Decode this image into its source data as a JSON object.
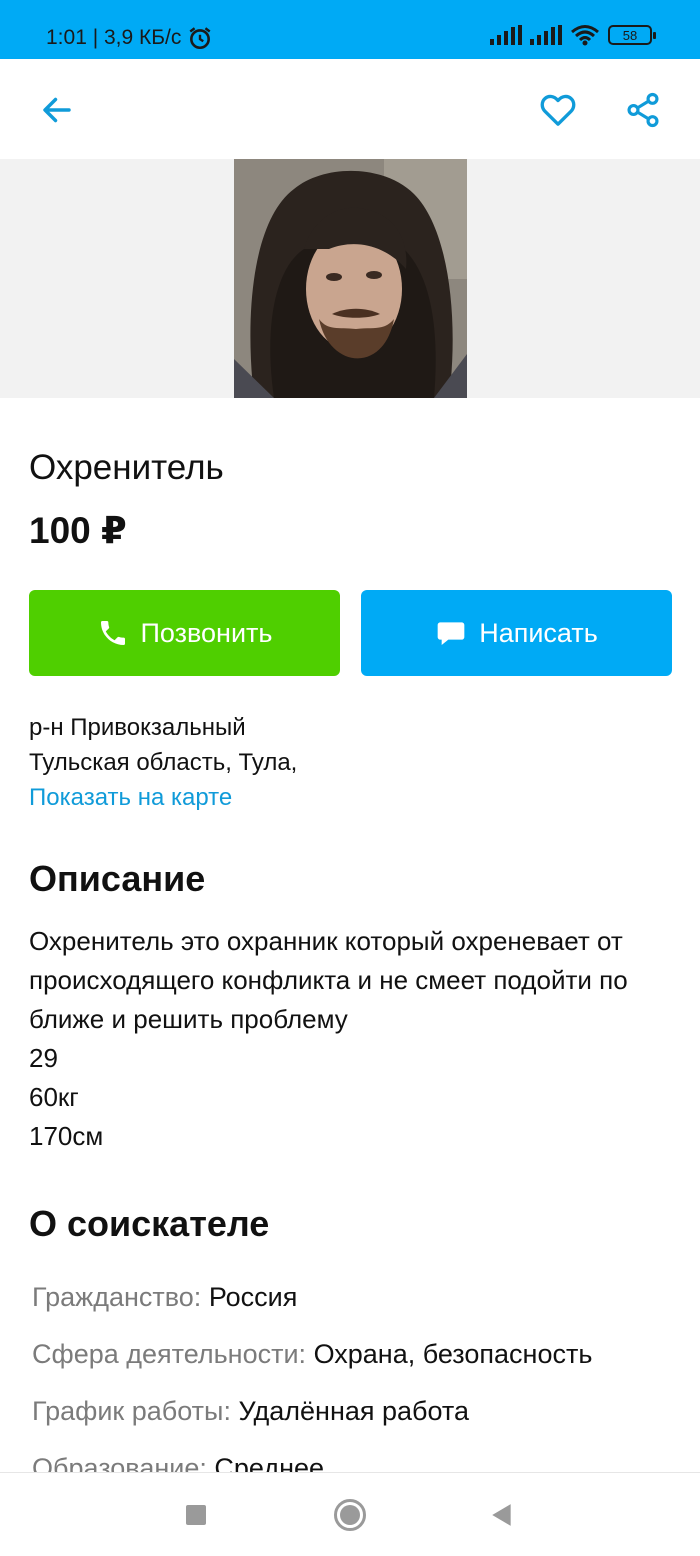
{
  "status_bar": {
    "time_speed": "1:01 | 3,9 КБ/с",
    "battery": "58"
  },
  "toolbar": {
    "back_icon": "arrow-left-icon",
    "favorite_icon": "heart-icon",
    "share_icon": "share-icon"
  },
  "listing": {
    "title": "Охренитель",
    "price": "100 ₽",
    "call_label": "Позвонить",
    "write_label": "Написать",
    "district": "р-н Привокзальный",
    "city": "Тульская область, Тула,",
    "map_link": "Показать на карте"
  },
  "description": {
    "heading": "Описание",
    "text": "Охренитель это охранник который охреневает от происходящего конфликта и не смеет подойти по ближе и решить проблему",
    "age": "29",
    "weight": "60кг",
    "height": "170см"
  },
  "applicant": {
    "heading": "О соискателе",
    "rows": [
      {
        "key": "Гражданство:",
        "value": "Россия"
      },
      {
        "key": "Сфера деятельности:",
        "value": "Охрана, безопасность"
      },
      {
        "key": "График работы:",
        "value": "Удалённая работа"
      },
      {
        "key": "Образование:",
        "value": "Среднее"
      }
    ]
  },
  "colors": {
    "accent_blue": "#00aaf5",
    "call_green": "#4fcf00",
    "link_blue": "#109bd9"
  }
}
